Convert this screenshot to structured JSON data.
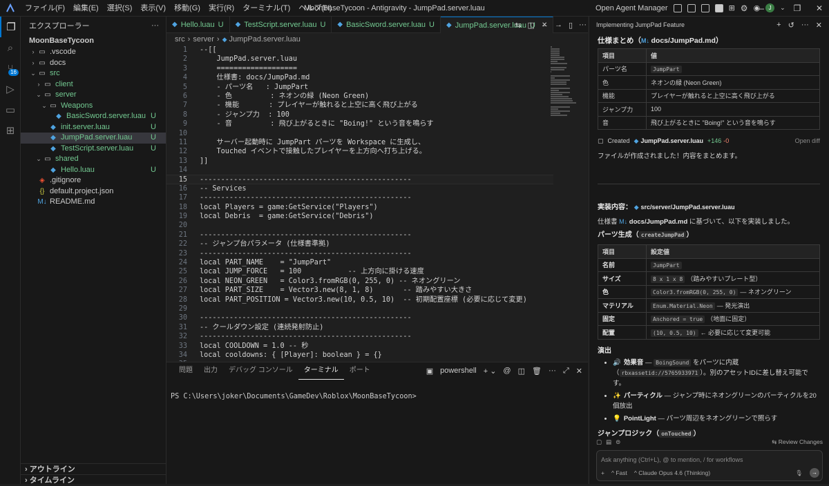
{
  "titlebar": {
    "menu": [
      "ファイル(F)",
      "編集(E)",
      "選択(S)",
      "表示(V)",
      "移動(G)",
      "実行(R)",
      "ターミナル(T)",
      "ヘルプ(H)"
    ],
    "window_title": "MoonBaseTycoon - Antigravity - JumpPad.server.luau",
    "agent_manager": "Open Agent Manager",
    "avatar_letter": "J"
  },
  "activity": {
    "scm_badge": "16"
  },
  "sidebar": {
    "header": "エクスプローラー",
    "root": "MoonBaseTycoon",
    "items": [
      {
        "label": ".vscode",
        "type": "folder",
        "depth": 1,
        "chev": "›",
        "status": ""
      },
      {
        "label": "docs",
        "type": "folder",
        "depth": 1,
        "chev": "›",
        "status": ""
      },
      {
        "label": "src",
        "type": "folder",
        "depth": 1,
        "chev": "⌄",
        "status": ""
      },
      {
        "label": "client",
        "type": "folder",
        "depth": 2,
        "chev": "›",
        "status": ""
      },
      {
        "label": "server",
        "type": "folder",
        "depth": 2,
        "chev": "⌄",
        "status": ""
      },
      {
        "label": "Weapons",
        "type": "folder",
        "depth": 3,
        "chev": "⌄",
        "status": ""
      },
      {
        "label": "BasicSword.server.luau",
        "type": "luau",
        "depth": 4,
        "chev": "",
        "status": "U"
      },
      {
        "label": "init.server.luau",
        "type": "luau",
        "depth": 3,
        "chev": "",
        "status": "U"
      },
      {
        "label": "JumpPad.server.luau",
        "type": "luau",
        "depth": 3,
        "chev": "",
        "status": "U",
        "selected": true
      },
      {
        "label": "TestScript.server.luau",
        "type": "luau",
        "depth": 3,
        "chev": "",
        "status": "U"
      },
      {
        "label": "shared",
        "type": "folder",
        "depth": 2,
        "chev": "⌄",
        "status": ""
      },
      {
        "label": "Hello.luau",
        "type": "luau",
        "depth": 3,
        "chev": "",
        "status": "U"
      },
      {
        "label": ".gitignore",
        "type": "git",
        "depth": 1,
        "chev": "",
        "status": ""
      },
      {
        "label": "default.project.json",
        "type": "json",
        "depth": 1,
        "chev": "",
        "status": ""
      },
      {
        "label": "README.md",
        "type": "md",
        "depth": 1,
        "chev": "",
        "status": ""
      }
    ],
    "outline": "アウトライン",
    "timeline": "タイムライン"
  },
  "editor": {
    "tabs": [
      {
        "label": "Hello.luau",
        "status": "U",
        "active": false
      },
      {
        "label": "TestScript.server.luau",
        "status": "U",
        "active": false
      },
      {
        "label": "BasicSword.server.luau",
        "status": "U",
        "active": false
      },
      {
        "label": "JumpPad.server.luau",
        "status": "U",
        "active": true
      }
    ],
    "breadcrumb": [
      "src",
      "server",
      "JumpPad.server.luau"
    ],
    "current_line": 15,
    "lines": [
      "--[[",
      "    JumpPad.server.luau",
      "    ===================",
      "    仕様書: docs/JumpPad.md",
      "    - パーツ名   : JumpPart",
      "    - 色         : ネオンの緑 (Neon Green)",
      "    - 機能       : プレイヤーが触れると上空に高く飛び上がる",
      "    - ジャンプ力  : 100",
      "    - 音         : 飛び上がるときに \"Boing!\" という音を鳴らす",
      "",
      "    サーバー起動時に JumpPart パーツを Workspace に生成し、",
      "    Touched イベントで接触したプレイヤーを上方向へ打ち上げる。",
      "]]",
      "",
      "--------------------------------------------------",
      "-- Services",
      "--------------------------------------------------",
      "local Players = game:GetService(\"Players\")",
      "local Debris  = game:GetService(\"Debris\")",
      "",
      "--------------------------------------------------",
      "-- ジャンプ台パラメータ (仕様書準拠)",
      "--------------------------------------------------",
      "local PART_NAME    = \"JumpPart\"",
      "local JUMP_FORCE   = 100           -- 上方向に掛ける速度",
      "local NEON_GREEN   = Color3.fromRGB(0, 255, 0) -- ネオングリーン",
      "local PART_SIZE    = Vector3.new(8, 1, 8)       -- 踏みやすい大きさ",
      "local PART_POSITION = Vector3.new(10, 0.5, 10)  -- 初期配置座標 (必要に応じて変更)",
      "",
      "--------------------------------------------------",
      "-- クールダウン設定 (連続発射防止)",
      "--------------------------------------------------",
      "local COOLDOWN = 1.0 -- 秒",
      "local cooldowns: { [Player]: boolean } = {}",
      ""
    ]
  },
  "panel": {
    "tabs": [
      "問題",
      "出力",
      "デバッグ コンソール",
      "ターミナル",
      "ポート"
    ],
    "active_tab": "ターミナル",
    "shell": "powershell",
    "prompt": "PS C:\\Users\\joker\\Documents\\GameDev\\Roblox\\MoonBaseTycoon>"
  },
  "agent": {
    "title": "Implementing JumpPad Feature",
    "spec_heading": "仕様まとめ（",
    "spec_file": "docs/JumpPad.md",
    "spec_heading_end": "）",
    "spec_table": {
      "headers": [
        "項目",
        "値"
      ],
      "rows": [
        [
          "パーツ名",
          "JumpPart"
        ],
        [
          "色",
          "ネオンの緑 (Neon Green)"
        ],
        [
          "機能",
          "プレイヤーが触れると上空に高く飛び上がる"
        ],
        [
          "ジャンプ力",
          "100"
        ],
        [
          "音",
          "飛び上がるときに \"Boing!\" という音を鳴らす"
        ]
      ]
    },
    "created_label": "Created",
    "created_file": "JumpPad.server.luau",
    "created_plus": "+146",
    "created_minus": "-0",
    "open_diff": "Open diff",
    "summary_text": "ファイルが作成されました！内容をまとめます。",
    "impl_label": "実装内容：",
    "impl_file": "src/server/JumpPad.server.luau",
    "based_pre": "仕様書",
    "based_file": "docs/JumpPad.md",
    "based_post": "に基づいて、以下を実装しました。",
    "parts_heading": "パーツ生成（",
    "parts_code": "createJumpPad",
    "parts_heading_end": "）",
    "parts_table": {
      "headers": [
        "項目",
        "設定値"
      ],
      "rows": [
        {
          "k": "名前",
          "code": "JumpPart",
          "note": ""
        },
        {
          "k": "サイズ",
          "code": "8 x 1 x 8",
          "note": "（踏みやすいプレート型）"
        },
        {
          "k": "色",
          "code": "Color3.fromRGB(0, 255, 0)",
          "note": "— ネオングリーン"
        },
        {
          "k": "マテリアル",
          "code": "Enum.Material.Neon",
          "note": "— 発光演出"
        },
        {
          "k": "固定",
          "code": "Anchored = true",
          "note": "（地面に固定）"
        },
        {
          "k": "配置",
          "code": "(10, 0.5, 10)",
          "note": "← 必要に応じて変更可能"
        }
      ]
    },
    "effects_heading": "演出",
    "effects": [
      {
        "icon": "🔊",
        "title": "効果音",
        "pre": " — ",
        "code": "BoingSound",
        "mid": " をパーツに内蔵（",
        "code2": "rbxassetid://5765933971",
        "post": "）。別のアセットIDに差し替え可能です。"
      },
      {
        "icon": "✨",
        "title": "パーティクル",
        "pre": " — ジャンプ時にネオングリーンのパーティクルを20個放出",
        "code": "",
        "mid": "",
        "code2": "",
        "post": ""
      },
      {
        "icon": "💡",
        "title": "PointLight",
        "pre": " — パーツ周辺をネオングリーンで照らす",
        "code": "",
        "mid": "",
        "code2": "",
        "post": ""
      }
    ],
    "jump_heading": "ジャンプロジック（",
    "jump_code": "onTouched",
    "jump_heading_end": "）",
    "review_changes": "Review Changes",
    "input_placeholder": "Ask anything (Ctrl+L), @ to mention, / for workflows",
    "mode": "Fast",
    "model": "Claude Opus 4.6 (Thinking)"
  }
}
